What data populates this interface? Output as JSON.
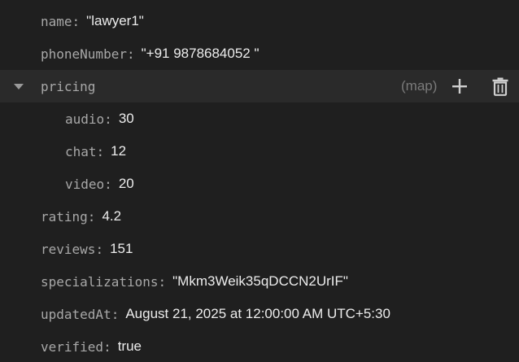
{
  "fields": {
    "name": {
      "key": "name",
      "value": "\"lawyer1\""
    },
    "phoneNumber": {
      "key": "phoneNumber",
      "value": "\"+91 9878684052 \""
    },
    "pricing": {
      "key": "pricing",
      "type_hint": "(map)",
      "children": {
        "audio": {
          "key": "audio",
          "value": "30"
        },
        "chat": {
          "key": "chat",
          "value": "12"
        },
        "video": {
          "key": "video",
          "value": "20"
        }
      }
    },
    "rating": {
      "key": "rating",
      "value": "4.2"
    },
    "reviews": {
      "key": "reviews",
      "value": "151"
    },
    "specializations": {
      "key": "specializations",
      "value": "\"Mkm3Weik35qDCCN2UrIF\""
    },
    "updatedAt": {
      "key": "updatedAt",
      "value": "August 21, 2025 at 12:00:00 AM UTC+5:30"
    },
    "verified": {
      "key": "verified",
      "value": "true"
    }
  },
  "icons": {
    "expand": "chevron-down-icon",
    "add": "add-icon",
    "delete": "trash-icon"
  },
  "colors": {
    "background": "#1f1f1f",
    "hover_row": "#2a2a2a",
    "key_text": "#a8a8a8",
    "value_text": "#ececec",
    "type_hint": "#7a7a7a",
    "icon": "#cfcfcf"
  }
}
